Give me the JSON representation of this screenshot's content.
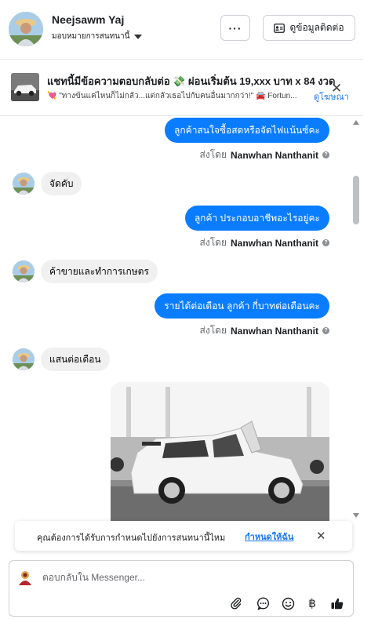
{
  "header": {
    "contact_name": "Neejsawm Yaj",
    "assign_label": "มอบหมายการสนทนานี้",
    "more_label": "···",
    "info_button_label": "ดูข้อมูลติดต่อ"
  },
  "ad": {
    "title": "แชทนี้มีข้อความตอบกลับต่อ 💸 ผ่อนเริ่มต้น 19,xxx บาท x 84 งวด",
    "description": "💘 \"ทางข้นแค่ไหนก็ไม่กลัว...แต่กลัวเธอไปกับคนอื่นมากกว่า!\" 🚘 Fortun...",
    "link_label": "ดูโฆษณา"
  },
  "messages": {
    "m1": "ลูกค้าสนใจซื้อสดหรือจัดไฟแน้นซ์คะ",
    "m2": "จัดคับ",
    "m3": "ลูกค้า ประกอบอาชีพอะไรอยู่คะ",
    "m4": "ค้าขายและทำการเกษตร",
    "m5": "รายได้ต่อเดือน ลูกค้า กี่บาทต่อเดือนคะ",
    "m6": "แสนต่อเดือน",
    "sent_prefix": "ส่งโดย",
    "sender_name": "Nanwhan Nanthanit"
  },
  "notice": {
    "text": "คุณต้องการได้รับการกำหนดไปยังการสนทนานี้ไหม",
    "action_label": "กำหนดให้ฉัน"
  },
  "composer": {
    "placeholder": "ตอบกลับใน Messenger..."
  },
  "colors": {
    "accent": "#0a7cff",
    "link": "#1877f2",
    "incoming_bubble": "#f0f0f0"
  },
  "icons": {
    "more": "more-horizontal-icon",
    "info": "contact-card-icon",
    "close": "close-icon",
    "attach": "paperclip-icon",
    "saved_reply": "chat-bubble-icon",
    "emoji": "smiley-icon",
    "payment": "baht-icon",
    "like": "thumbs-up-icon"
  }
}
